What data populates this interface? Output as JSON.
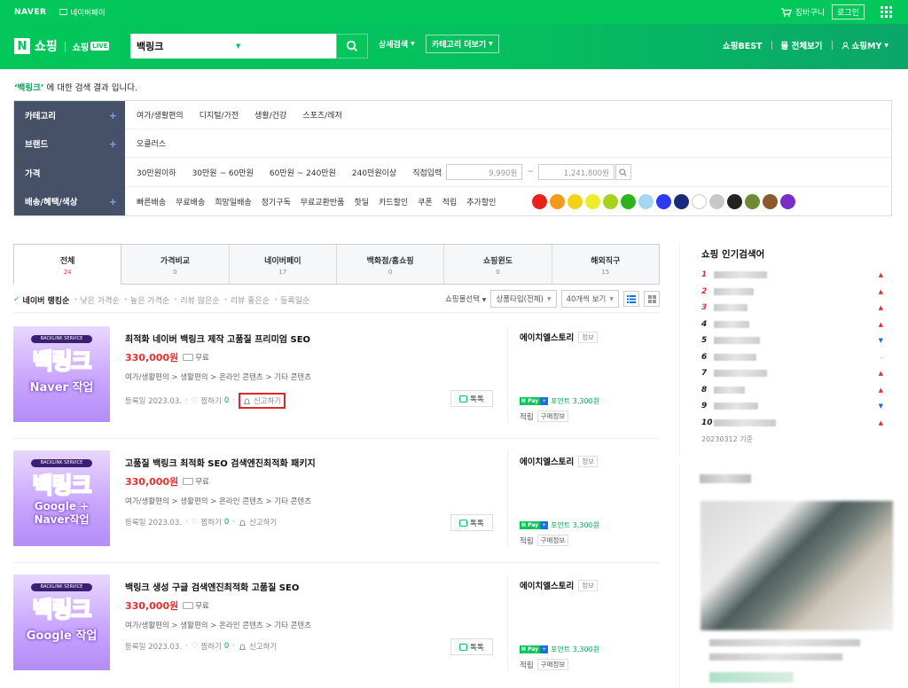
{
  "topbar": {
    "brand": "NAVER",
    "pay_label": "네이버페이",
    "cart_label": "장바구니",
    "login_label": "로그인"
  },
  "header": {
    "logo_n": "N",
    "logo_text": "쇼핑",
    "live_prefix": "쇼핑",
    "live_badge": "LIVE",
    "search_value": "백링크",
    "detail_search": "상세검색",
    "category_more": "카테고리 더보기",
    "nav": [
      "쇼핑BEST",
      "몰 전체보기",
      "쇼핑MY"
    ]
  },
  "result": {
    "keyword": "‘백링크’",
    "suffix": " 에 대한 검색 결과 입니다."
  },
  "filters": {
    "category": {
      "label": "카테고리",
      "items": [
        "여가/생활편의",
        "디지털/가전",
        "생활/건강",
        "스포츠/레저"
      ]
    },
    "brand": {
      "label": "브랜드",
      "items": [
        "오클러스"
      ]
    },
    "price": {
      "label": "가격",
      "items": [
        "30만원이하",
        "30만원 ~ 60만원",
        "60만원 ~ 240만원",
        "240만원이상"
      ],
      "direct": "직접입력",
      "min_placeholder": "9,990원",
      "max_placeholder": "1,241,800원",
      "separator": "~"
    },
    "benefit": {
      "label": "배송/혜택/색상",
      "items": [
        "빠른배송",
        "무료배송",
        "희망일배송",
        "정기구독",
        "무료교환반품",
        "핫딜",
        "카드할인",
        "쿠폰",
        "적립",
        "추가할인"
      ]
    },
    "colors": [
      "#e8221b",
      "#f29a1b",
      "#f5d21a",
      "#ecec2a",
      "#a7d21c",
      "#2fb21c",
      "#a5d6f2",
      "#2b3bf0",
      "#1b2a7d",
      "#ffffff",
      "#c8c8c8",
      "#222222",
      "#6f8a34",
      "#8c5a2a",
      "#7a2ec7"
    ]
  },
  "tabs": [
    {
      "label": "전체",
      "count": "24"
    },
    {
      "label": "가격비교",
      "count": "0"
    },
    {
      "label": "네이버페이",
      "count": "17"
    },
    {
      "label": "백화점/홈쇼핑",
      "count": "0"
    },
    {
      "label": "쇼핑윈도",
      "count": "0"
    },
    {
      "label": "해외직구",
      "count": "15"
    }
  ],
  "sort": {
    "options": [
      "네이버 랭킹순",
      "낮은 가격순",
      "높은 가격순",
      "리뷰 많은순",
      "리뷰 좋은순",
      "등록일순"
    ],
    "mall_select": "쇼핑몰선택",
    "product_type": "상품타입(전체)",
    "per_page": "40개씩 보기"
  },
  "products": [
    {
      "thumb_badge": "BACKLINK SERVICE",
      "thumb_title": "백링크",
      "thumb_sub": "Naver 작업",
      "title": "최적화 네이버 백링크 제작 고품질 프리미엄 SEO",
      "price": "330,000원",
      "shipping": "무료",
      "category": "여가/생활편의 > 생활편의 > 온라인 콘텐츠 > 기타 콘텐츠",
      "date": "등록일 2023.03.",
      "wish": "찜하기",
      "wish_count": "0",
      "report": "신고하기",
      "talk": "톡톡",
      "store": "에이치엘스토리",
      "store_info": "정보",
      "npay_label": "Pay",
      "point": "포인트 3,300원",
      "accum": "적립",
      "buy_info": "구매정보"
    },
    {
      "thumb_badge": "BACKLINK SERVICE",
      "thumb_title": "백링크",
      "thumb_sub": "Google + Naver작업",
      "title": "고품질 백링크 최적화 SEO 검색엔진최적화 패키지",
      "price": "330,000원",
      "shipping": "무료",
      "category": "여가/생활편의 > 생활편의 > 온라인 콘텐츠 > 기타 콘텐츠",
      "date": "등록일 2023.03.",
      "wish": "찜하기",
      "wish_count": "0",
      "report": "신고하기",
      "talk": "톡톡",
      "store": "에이치엘스토리",
      "store_info": "정보",
      "npay_label": "Pay",
      "point": "포인트 3,300원",
      "accum": "적립",
      "buy_info": "구매정보"
    },
    {
      "thumb_badge": "BACKLINK SERVICE",
      "thumb_title": "백링크",
      "thumb_sub": "Google 작업",
      "title": "백링크 생성 구글 검색엔진최적화 고품질 SEO",
      "price": "330,000원",
      "shipping": "무료",
      "category": "여가/생활편의 > 생활편의 > 온라인 콘텐츠 > 기타 콘텐츠",
      "date": "등록일 2023.03.",
      "wish": "찜하기",
      "wish_count": "0",
      "report": "신고하기",
      "talk": "톡톡",
      "store": "에이치엘스토리",
      "store_info": "정보",
      "npay_label": "Pay",
      "point": "포인트 3,300원",
      "accum": "적립",
      "buy_info": "구매정보"
    }
  ],
  "popular": {
    "title": "쇼핑 인기검색어",
    "ranks": [
      {
        "n": "1",
        "trend": "up"
      },
      {
        "n": "2",
        "trend": "up"
      },
      {
        "n": "3",
        "trend": "up"
      },
      {
        "n": "4",
        "trend": "up"
      },
      {
        "n": "5",
        "trend": "down"
      },
      {
        "n": "6",
        "trend": "same"
      },
      {
        "n": "7",
        "trend": "up"
      },
      {
        "n": "8",
        "trend": "up"
      },
      {
        "n": "9",
        "trend": "down"
      },
      {
        "n": "10",
        "trend": "up"
      }
    ],
    "date": "20230312 기준"
  }
}
